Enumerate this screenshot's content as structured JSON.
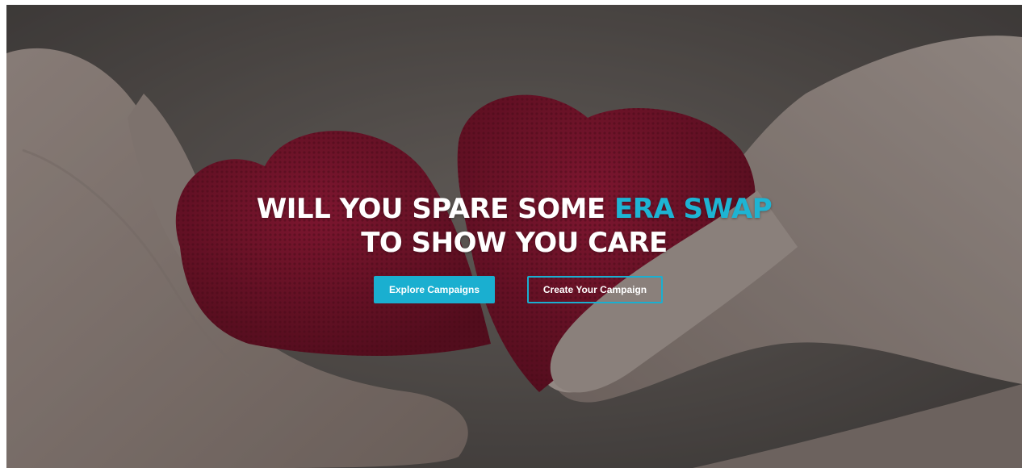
{
  "hero": {
    "headline": {
      "line1_prefix": "WILL YOU SPARE SOME ",
      "line1_accent": "ERA SWAP",
      "line2": "TO SHOW YOU CARE"
    },
    "explore_label": "Explore Campaigns",
    "create_label": "Create Your Campaign"
  },
  "colors": {
    "accent": "#1eb4d3",
    "heart": "#8e0f2b",
    "overlay": "#5d5856"
  }
}
